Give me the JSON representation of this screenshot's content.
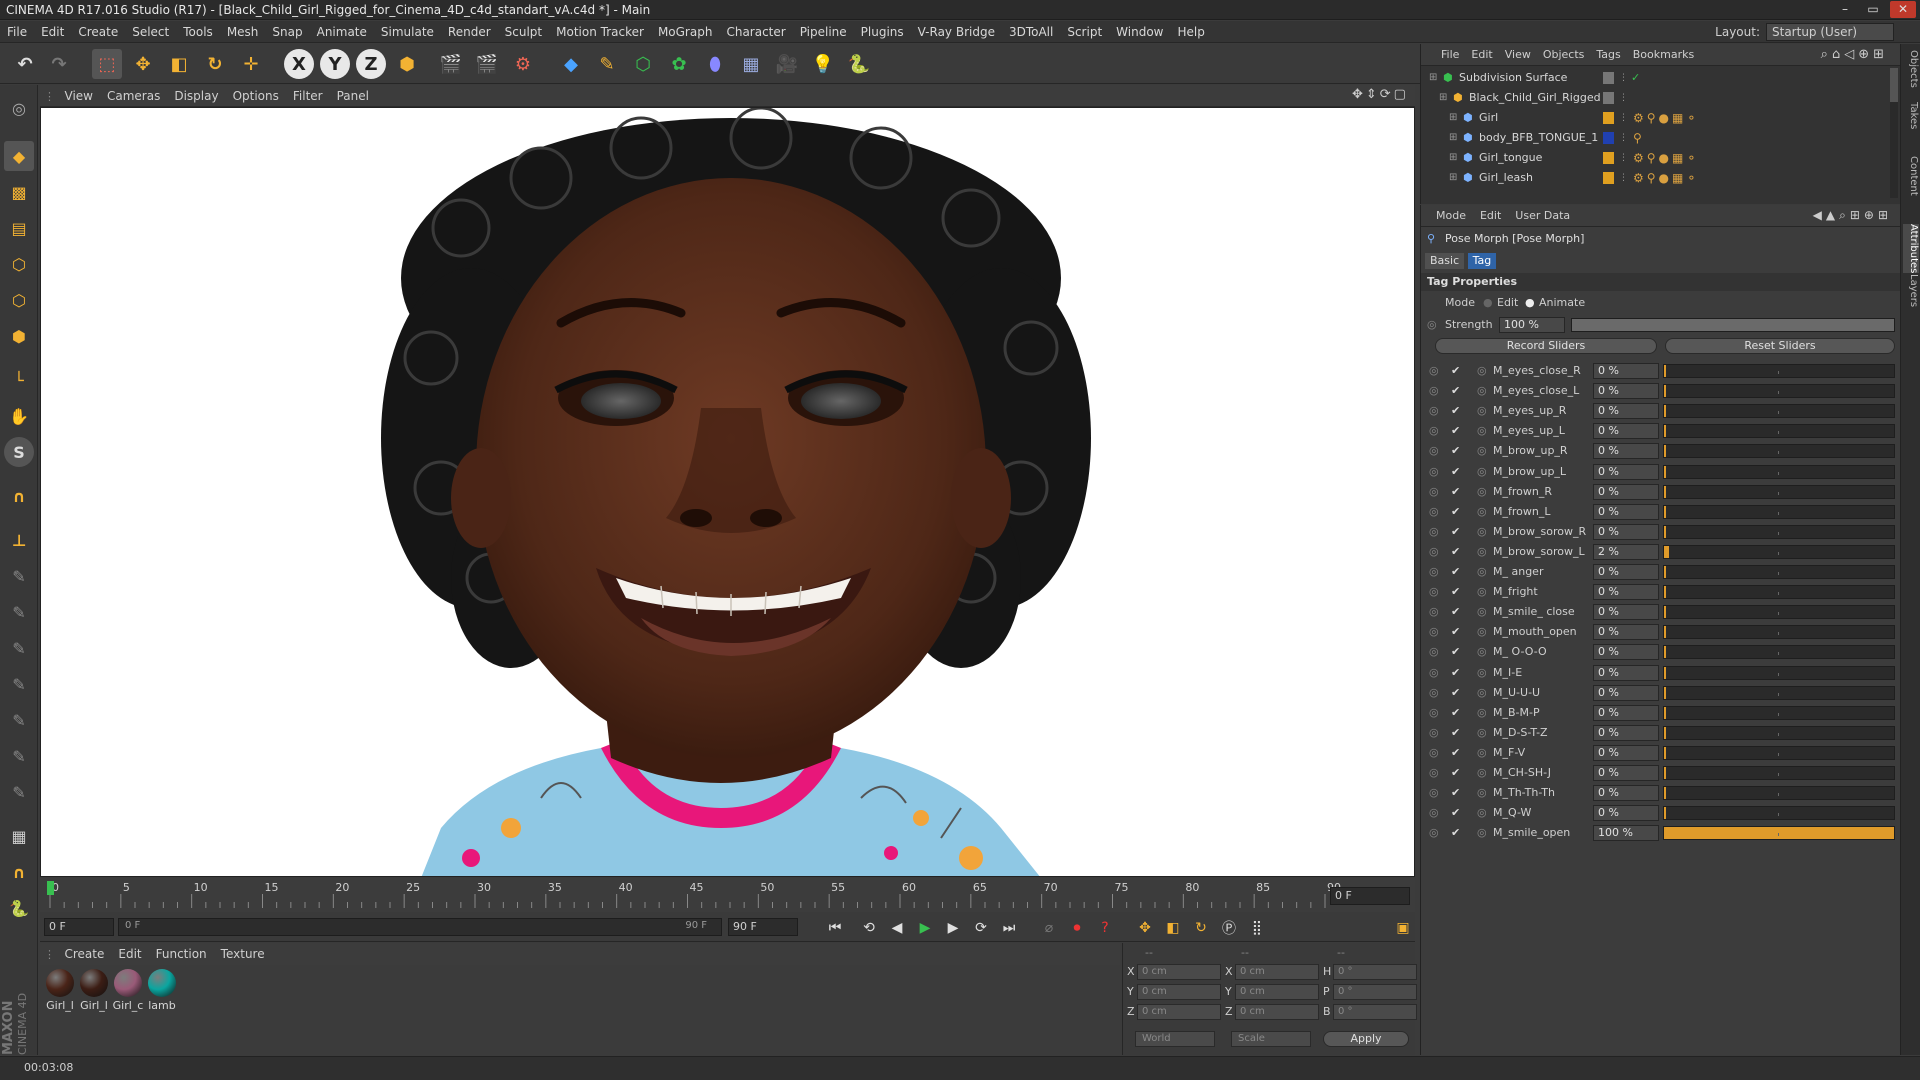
{
  "window": {
    "title": "CINEMA 4D R17.016 Studio (R17) - [Black_Child_Girl_Rigged_for_Cinema_4D_c4d_standart_vA.c4d *] - Main"
  },
  "menubar": {
    "items": [
      "File",
      "Edit",
      "Create",
      "Select",
      "Tools",
      "Mesh",
      "Snap",
      "Animate",
      "Simulate",
      "Render",
      "Sculpt",
      "Motion Tracker",
      "MoGraph",
      "Character",
      "Pipeline",
      "Plugins",
      "V-Ray Bridge",
      "3DToAll",
      "Script",
      "Window",
      "Help"
    ],
    "layout_label": "Layout:",
    "layout_value": "Startup (User)"
  },
  "viewport": {
    "menu": [
      "View",
      "Cameras",
      "Display",
      "Options",
      "Filter",
      "Panel"
    ]
  },
  "timeline": {
    "ticks": [
      "0",
      "5",
      "10",
      "15",
      "20",
      "25",
      "30",
      "35",
      "40",
      "45",
      "50",
      "55",
      "60",
      "65",
      "70",
      "75",
      "80",
      "85",
      "90"
    ],
    "current_frame": "0 F"
  },
  "transport": {
    "start_field": "0 F",
    "range_start": "0 F",
    "range_end": "90 F",
    "end_field": "90 F"
  },
  "materials": {
    "menu": [
      "Create",
      "Edit",
      "Function",
      "Texture"
    ],
    "items": [
      {
        "label": "Girl_l",
        "color": "#4a2418"
      },
      {
        "label": "Girl_l",
        "color": "#3c1d14"
      },
      {
        "label": "Girl_c",
        "color": "#9a5a78"
      },
      {
        "label": "lamb",
        "color": "#0aa6a0"
      }
    ]
  },
  "coords": {
    "headers": [
      "--",
      "--",
      "--"
    ],
    "rows": [
      {
        "a1": "X",
        "v1": "0 cm",
        "a2": "X",
        "v2": "0 cm",
        "a3": "H",
        "v3": "0 °"
      },
      {
        "a1": "Y",
        "v1": "0 cm",
        "a2": "Y",
        "v2": "0 cm",
        "a3": "P",
        "v3": "0 °"
      },
      {
        "a1": "Z",
        "v1": "0 cm",
        "a2": "Z",
        "v2": "0 cm",
        "a3": "B",
        "v3": "0 °"
      }
    ],
    "space": "World",
    "mode": "Scale",
    "apply": "Apply"
  },
  "status": {
    "time": "00:03:08"
  },
  "objects": {
    "menu": [
      "File",
      "Edit",
      "View",
      "Objects",
      "Tags",
      "Bookmarks"
    ],
    "rows": [
      {
        "name": "Subdivision Surface",
        "indent": 0
      },
      {
        "name": "Black_Child_Girl_Rigged",
        "indent": 1
      },
      {
        "name": "Girl",
        "indent": 2
      },
      {
        "name": "body_BFB_TONGUE_1",
        "indent": 2
      },
      {
        "name": "Girl_tongue",
        "indent": 2
      },
      {
        "name": "Girl_leash",
        "indent": 2
      }
    ]
  },
  "attributes": {
    "menu": [
      "Mode",
      "Edit",
      "User Data"
    ],
    "header": "Pose Morph [Pose Morph]",
    "tabs": [
      "Basic",
      "Tag"
    ],
    "section": "Tag Properties",
    "mode_label": "Mode",
    "mode_options": [
      "Edit",
      "Animate"
    ],
    "strength_label": "Strength",
    "strength_value": "100 %",
    "strength_fraction": 1.0,
    "record_btn": "Record Sliders",
    "reset_btn": "Reset Sliders",
    "morphs": [
      {
        "name": "M_eyes_close_R",
        "value": "0 %",
        "fraction": 0
      },
      {
        "name": "M_eyes_close_L",
        "value": "0 %",
        "fraction": 0
      },
      {
        "name": "M_eyes_up_R",
        "value": "0 %",
        "fraction": 0
      },
      {
        "name": "M_eyes_up_L",
        "value": "0 %",
        "fraction": 0
      },
      {
        "name": "M_brow_up_R",
        "value": "0 %",
        "fraction": 0
      },
      {
        "name": "M_brow_up_L",
        "value": "0 %",
        "fraction": 0
      },
      {
        "name": "M_frown_R",
        "value": "0 %",
        "fraction": 0
      },
      {
        "name": "M_frown_L",
        "value": "0 %",
        "fraction": 0
      },
      {
        "name": "M_brow_sorow_R",
        "value": "0 %",
        "fraction": 0
      },
      {
        "name": "M_brow_sorow_L",
        "value": "2 %",
        "fraction": 0.02
      },
      {
        "name": "M_ anger",
        "value": "0 %",
        "fraction": 0
      },
      {
        "name": "M_fright",
        "value": "0 %",
        "fraction": 0
      },
      {
        "name": "M_smile_ close",
        "value": "0 %",
        "fraction": 0
      },
      {
        "name": "M_mouth_open",
        "value": "0 %",
        "fraction": 0
      },
      {
        "name": "M_ O-O-O",
        "value": "0 %",
        "fraction": 0
      },
      {
        "name": "M_I-E",
        "value": "0 %",
        "fraction": 0
      },
      {
        "name": "M_U-U-U",
        "value": "0 %",
        "fraction": 0
      },
      {
        "name": "M_B-M-P",
        "value": "0 %",
        "fraction": 0
      },
      {
        "name": "M_D-S-T-Z",
        "value": "0 %",
        "fraction": 0
      },
      {
        "name": "M_F-V",
        "value": "0 %",
        "fraction": 0
      },
      {
        "name": "M_CH-SH-J",
        "value": "0 %",
        "fraction": 0
      },
      {
        "name": "M_Th-Th-Th",
        "value": "0 %",
        "fraction": 0
      },
      {
        "name": "M_Q-W",
        "value": "0 %",
        "fraction": 0
      },
      {
        "name": "M_smile_open",
        "value": "100 %",
        "fraction": 1.0
      }
    ]
  },
  "side_tabs": [
    "Objects",
    "Takes",
    "Content",
    "Attributes",
    "Layers"
  ],
  "logo": {
    "line1": "MAXON",
    "line2": "CINEMA 4D"
  }
}
